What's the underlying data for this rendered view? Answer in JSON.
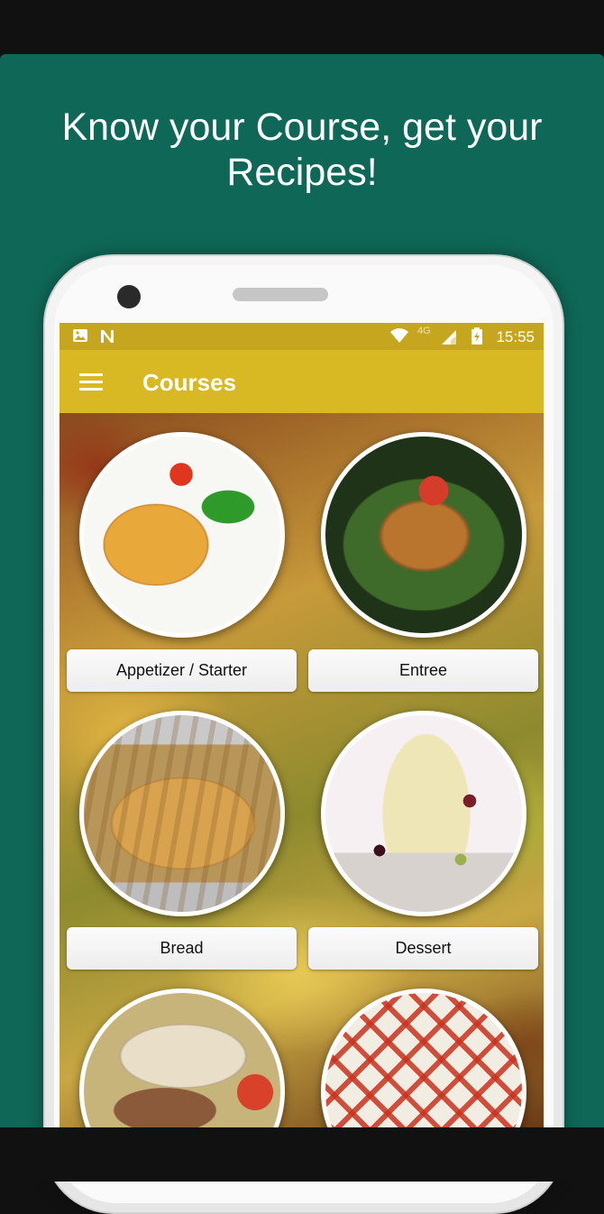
{
  "promo": {
    "headline": "Know your Course, get your Recipes!"
  },
  "status_bar": {
    "time": "15:55",
    "network": "4G",
    "icons": [
      "image-icon",
      "n-icon",
      "wifi-icon",
      "signal-icon",
      "battery-icon"
    ]
  },
  "app_bar": {
    "title": "Courses",
    "menu_icon": "hamburger-menu-icon"
  },
  "courses": [
    {
      "label": "Appetizer / Starter"
    },
    {
      "label": "Entree"
    },
    {
      "label": "Bread"
    },
    {
      "label": "Dessert"
    },
    {
      "label": ""
    },
    {
      "label": ""
    }
  ],
  "colors": {
    "promo_background": "#0f6857",
    "status_bar": "#c6a61f",
    "app_bar": "#d8b823",
    "app_title": "#ffffff"
  }
}
